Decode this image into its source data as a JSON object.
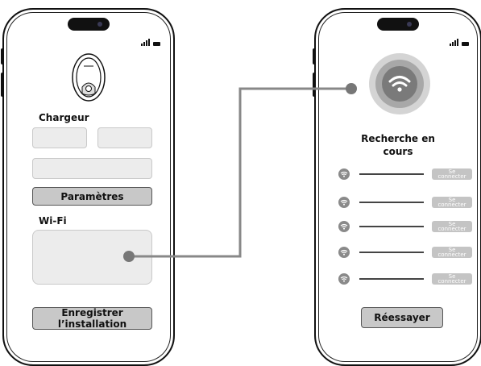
{
  "left_screen": {
    "section_charger": "Chargeur",
    "params_button": "Paramètres",
    "section_wifi": "Wi-Fi",
    "save_button_line1": "Enregistrer",
    "save_button_line2": "l’installation"
  },
  "right_screen": {
    "searching_line1": "Recherche en",
    "searching_line2": "cours",
    "networks": [
      {
        "connect_line1": "Se",
        "connect_line2": "connecter"
      },
      {
        "connect_line1": "Se",
        "connect_line2": "connecter"
      },
      {
        "connect_line1": "Se",
        "connect_line2": "connecter"
      },
      {
        "connect_line1": "Se",
        "connect_line2": "connecter"
      },
      {
        "connect_line1": "Se",
        "connect_line2": "connecter"
      }
    ],
    "retry_button": "Réessayer"
  },
  "icons": [
    "signal-icon",
    "battery-icon",
    "charger-icon",
    "wifi-icon"
  ]
}
